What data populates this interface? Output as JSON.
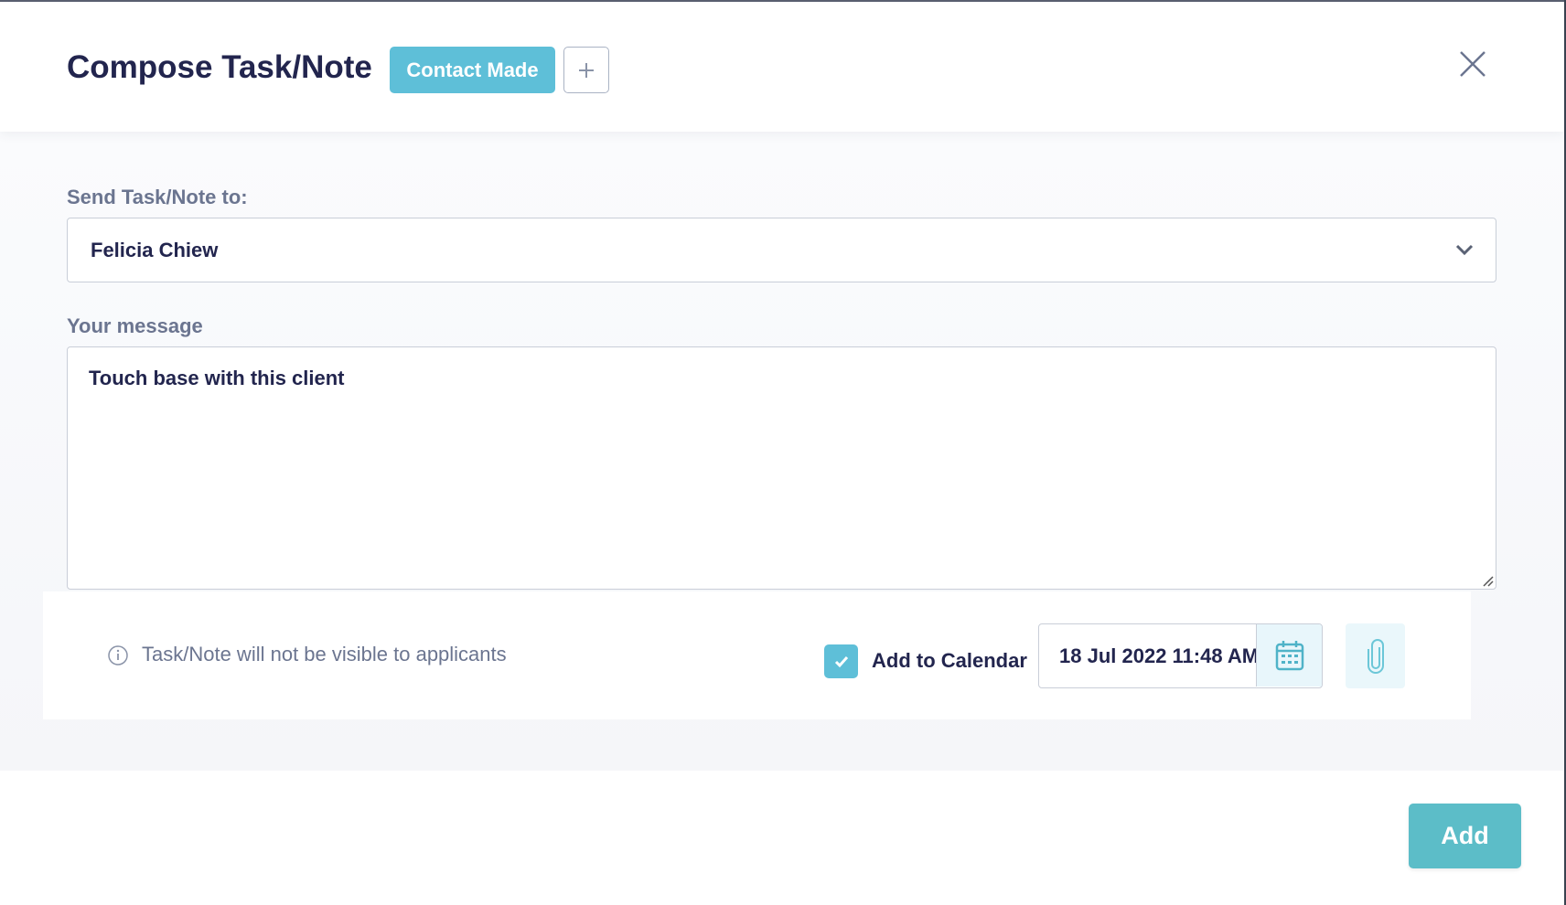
{
  "header": {
    "title": "Compose Task/Note",
    "tag_label": "Contact Made",
    "add_tag_icon": "plus-icon",
    "close_icon": "close-icon"
  },
  "form": {
    "recipient_label": "Send Task/Note to:",
    "recipient_value": "Felicia Chiew",
    "message_label": "Your message",
    "message_value": "Touch base with this client"
  },
  "options": {
    "visibility_note": "Task/Note will not be visible to applicants",
    "add_to_calendar_label": "Add to Calendar",
    "add_to_calendar_checked": true,
    "date_value": "18 Jul 2022 11:48 AM"
  },
  "footer": {
    "submit_label": "Add"
  },
  "colors": {
    "accent": "#5ebfd8",
    "submit": "#5cbdc8",
    "text_dark": "#22254e",
    "text_muted": "#6b7590"
  }
}
